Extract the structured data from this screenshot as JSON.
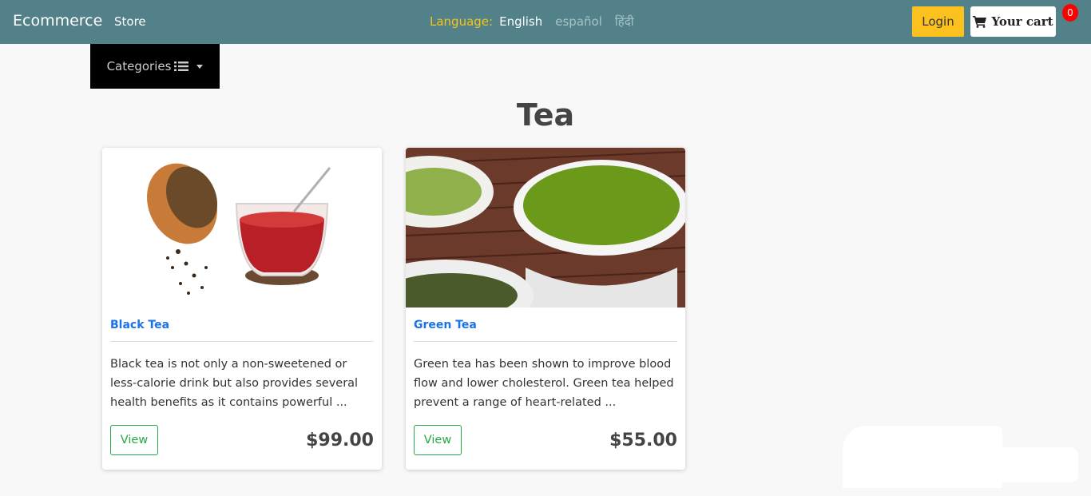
{
  "navbar": {
    "brand": "Ecommerce",
    "store_link": "Store",
    "language_label": "Language:",
    "languages": [
      "English",
      "español",
      "हिंदी"
    ],
    "login_label": "Login",
    "cart_label": "Your cart",
    "cart_count": "0"
  },
  "categories": {
    "label": "Categories"
  },
  "page": {
    "title": "Tea"
  },
  "products": [
    {
      "name": "Black Tea",
      "description": "Black tea is not only a non-sweetened or less-calorie drink but also provides several health benefits as it contains powerful ...",
      "view_label": "View",
      "price": "$99.00"
    },
    {
      "name": "Green Tea",
      "description": "Green tea has been shown to improve blood flow and lower cholesterol. Green tea helped prevent a range of heart-related ...",
      "view_label": "View",
      "price": "$55.00"
    }
  ],
  "colors": {
    "navbar": "#528189",
    "login": "#fbc21f",
    "language_label": "#f5c518",
    "product_title": "#1a73e8",
    "view_button": "#28a745",
    "badge": "#ff0000"
  },
  "icons": {
    "cart": "shopping-cart-icon",
    "categories": "list-icon",
    "dropdown": "caret-down-icon"
  }
}
